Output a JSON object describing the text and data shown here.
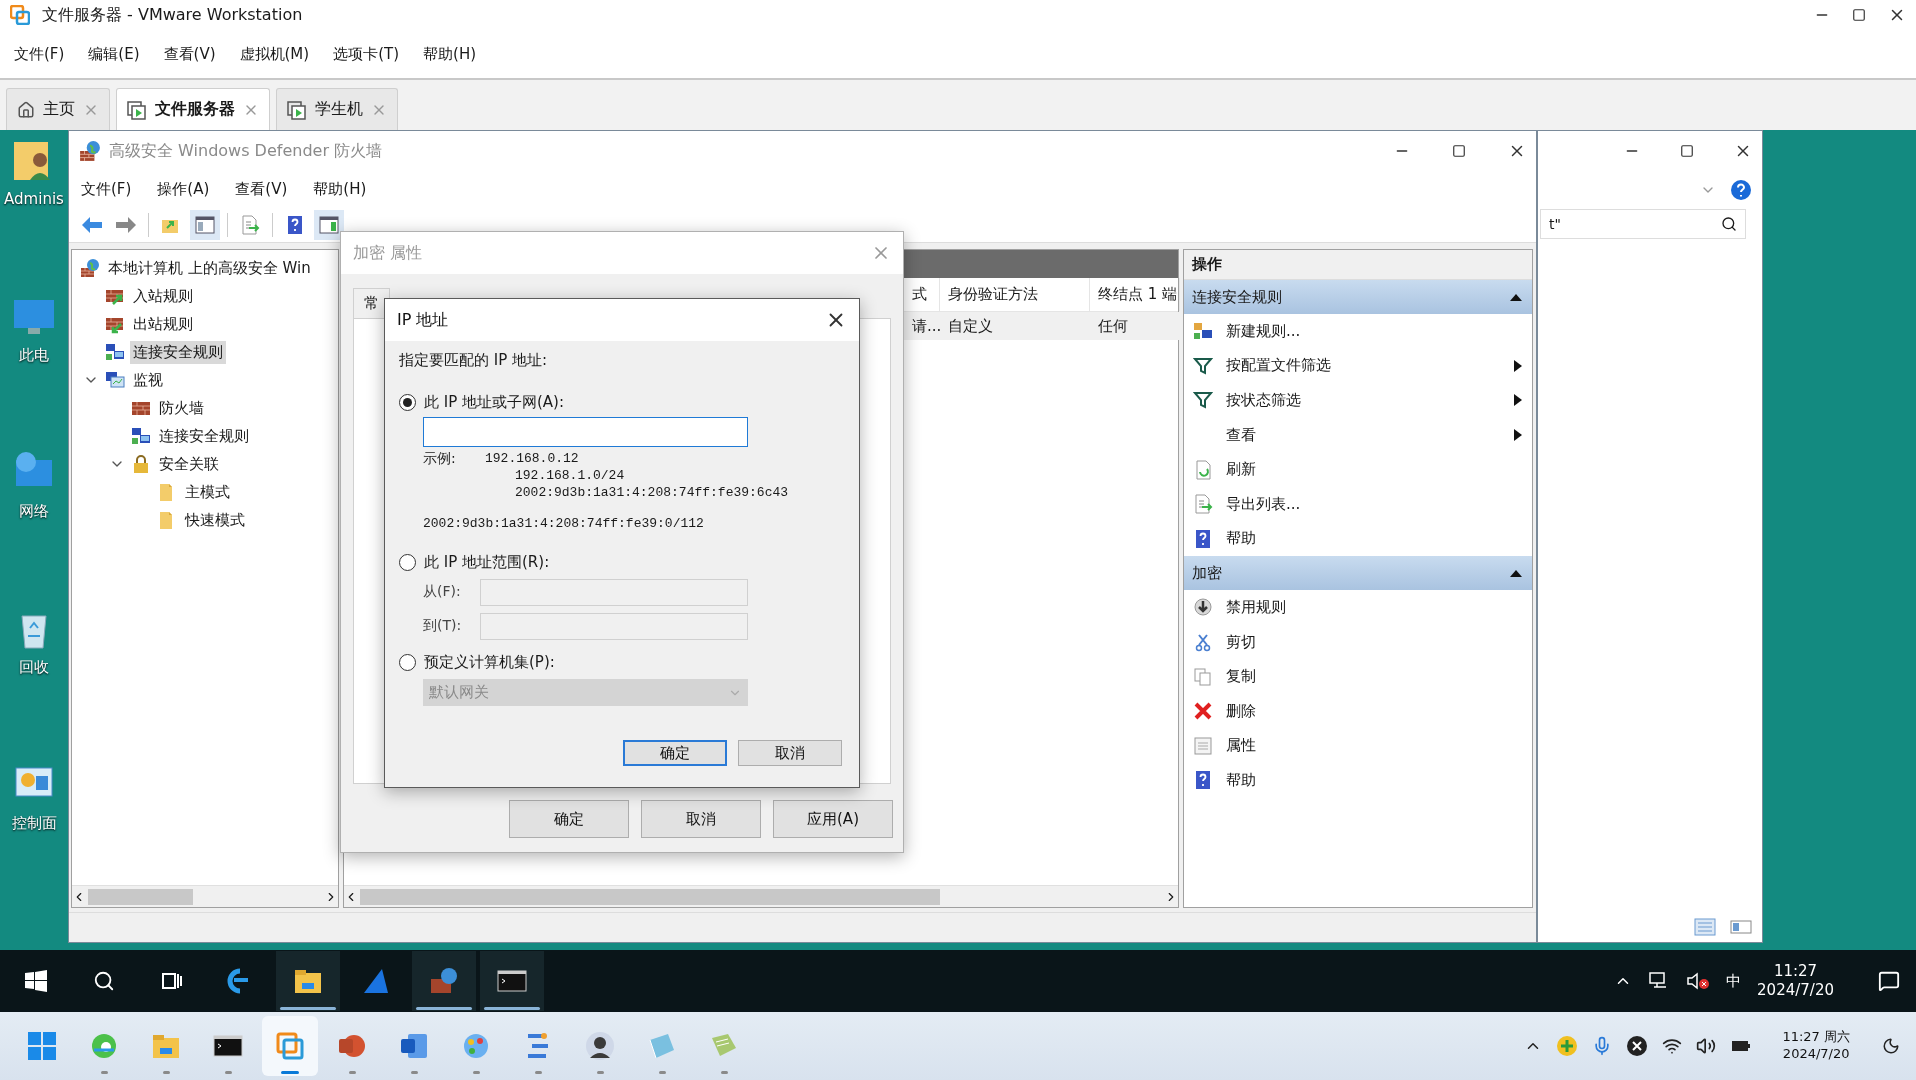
{
  "app": {
    "title": "文件服务器 - VMware Workstation",
    "menu": [
      "文件(F)",
      "编辑(E)",
      "查看(V)",
      "虚拟机(M)",
      "选项卡(T)",
      "帮助(H)"
    ],
    "tabs": [
      {
        "label": "主页",
        "kind": "home",
        "selected": false
      },
      {
        "label": "文件服务器",
        "kind": "vm",
        "selected": true
      },
      {
        "label": "学生机",
        "kind": "vm",
        "selected": false
      }
    ]
  },
  "desktop_icons": [
    {
      "label": "Adminis",
      "kind": "user-folder"
    },
    {
      "label": "此电",
      "kind": "computer"
    },
    {
      "label": "网络",
      "kind": "network"
    },
    {
      "label": "回收",
      "kind": "recycle"
    },
    {
      "label": "控制面",
      "kind": "control"
    }
  ],
  "firewall": {
    "title": "高级安全 Windows Defender 防火墙",
    "menu": [
      "文件(F)",
      "操作(A)",
      "查看(V)",
      "帮助(H)"
    ],
    "tree": [
      {
        "label": "本地计算机 上的高级安全 Win",
        "kind": "root",
        "selected": false,
        "children": [
          {
            "label": "入站规则",
            "kind": "inbound",
            "selected": false
          },
          {
            "label": "出站规则",
            "kind": "outbound",
            "selected": false
          },
          {
            "label": "连接安全规则",
            "kind": "connection",
            "selected": true
          },
          {
            "label": "监视",
            "kind": "monitor",
            "selected": false,
            "expanded": true,
            "children": [
              {
                "label": "防火墙",
                "kind": "firewall",
                "selected": false
              },
              {
                "label": "连接安全规则",
                "kind": "connection",
                "selected": false
              },
              {
                "label": "安全关联",
                "kind": "lock",
                "selected": false,
                "expanded": true,
                "children": [
                  {
                    "label": "主模式",
                    "kind": "folder",
                    "selected": false
                  },
                  {
                    "label": "快速模式",
                    "kind": "folder",
                    "selected": false
                  }
                ]
              }
            ]
          }
        ]
      }
    ],
    "table": {
      "columns": [
        "式",
        "身份验证方法",
        "终结点 1 端"
      ],
      "rows": [
        [
          "请...",
          "自定义",
          "任何"
        ]
      ]
    },
    "actions": {
      "title": "操作",
      "sections": [
        {
          "title": "连接安全规则",
          "expanded": true,
          "items": [
            {
              "label": "新建规则...",
              "kind": "new",
              "submenu": false
            },
            {
              "label": "按配置文件筛选",
              "kind": "filter",
              "submenu": true
            },
            {
              "label": "按状态筛选",
              "kind": "filter",
              "submenu": true
            },
            {
              "label": "查看",
              "kind": "none",
              "submenu": true
            },
            {
              "label": "刷新",
              "kind": "refresh",
              "submenu": false
            },
            {
              "label": "导出列表...",
              "kind": "export",
              "submenu": false
            },
            {
              "label": "帮助",
              "kind": "help",
              "submenu": false
            }
          ]
        },
        {
          "title": "加密",
          "expanded": true,
          "items": [
            {
              "label": "禁用规则",
              "kind": "disable",
              "submenu": false
            },
            {
              "label": "剪切",
              "kind": "cut",
              "submenu": false
            },
            {
              "label": "复制",
              "kind": "copy",
              "submenu": false
            },
            {
              "label": "删除",
              "kind": "delete",
              "submenu": false
            },
            {
              "label": "属性",
              "kind": "properties",
              "submenu": false
            },
            {
              "label": "帮助",
              "kind": "help",
              "submenu": false
            }
          ]
        }
      ]
    }
  },
  "side_window": {
    "search": {
      "value": "t\""
    }
  },
  "properties_dialog": {
    "title": "加密 属性",
    "tabs": [
      {
        "label": "常",
        "selected": false
      }
    ],
    "buttons": [
      "确定",
      "取消",
      "应用(A)"
    ]
  },
  "ip_dialog": {
    "title": "IP 地址",
    "prompt": "指定要匹配的 IP 地址:",
    "options": [
      {
        "kind": "subnet",
        "label": "此 IP 地址或子网(A):",
        "selected": true,
        "example_label": "示例:",
        "examples": [
          "192.168.0.12",
          "192.168.1.0/24",
          "2002:9d3b:1a31:4:208:74ff:fe39:6c43"
        ],
        "extra_example": "2002:9d3b:1a31:4:208:74ff:fe39:0/112"
      },
      {
        "kind": "range",
        "label": "此 IP 地址范围(R):",
        "selected": false,
        "fields": [
          {
            "label": "从(F):",
            "disabled": true
          },
          {
            "label": "到(T):",
            "disabled": true
          }
        ]
      },
      {
        "kind": "preset",
        "label": "预定义计算机集(P):",
        "selected": false,
        "select": {
          "value": "默认网关",
          "disabled": true
        }
      }
    ],
    "buttons": [
      {
        "label": "确定",
        "default": true
      },
      {
        "label": "取消",
        "default": false
      }
    ]
  },
  "guest_taskbar": {
    "apps": [
      {
        "kind": "ie",
        "active": false
      },
      {
        "kind": "explorer",
        "active": true
      },
      {
        "kind": "fin",
        "active": false
      },
      {
        "kind": "firewall",
        "active": true
      },
      {
        "kind": "cmd",
        "active": true
      }
    ],
    "ime": "中",
    "time": "11:27",
    "date": "2024/7/20"
  },
  "host_taskbar": {
    "apps": [
      {
        "kind": "edge",
        "active": false
      },
      {
        "kind": "explorer",
        "active": false
      },
      {
        "kind": "cmd",
        "active": false
      },
      {
        "kind": "vmware",
        "active": true
      },
      {
        "kind": "ppt",
        "active": false
      },
      {
        "kind": "word",
        "active": false
      },
      {
        "kind": "paint",
        "active": false
      },
      {
        "kind": "tool",
        "active": false
      },
      {
        "kind": "avatar",
        "active": false
      },
      {
        "kind": "notes",
        "active": false
      },
      {
        "kind": "book",
        "active": false
      }
    ],
    "time": "11:27 周六",
    "date": "2024/7/20"
  }
}
